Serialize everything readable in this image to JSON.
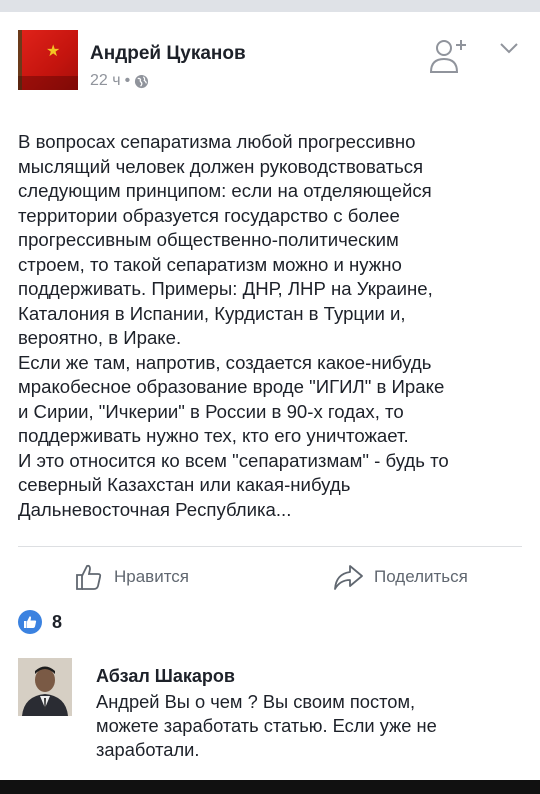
{
  "post": {
    "author": "Андрей Цуканов",
    "time": "22 ч",
    "separator": "•",
    "text": "В вопросах сепаратизма любой прогрессивно\nмыслящий человек должен руководствоваться\nследующим принципом: если на отделяющейся\nтерритории образуется государство с более\nпрогрессивным общественно-политическим\nстроем, то такой сепаратизм можно и нужно\nподдерживать. Примеры: ДНР, ЛНР на Украине,\nКаталония в Испании, Курдистан в Турции и,\nвероятно, в Ираке.\nЕсли же там, напротив, создается какое-нибудь\nмракобесное образование вроде \"ИГИЛ\" в Ираке\nи Сирии, \"Ичкерии\" в России в 90-х годах, то\nподдерживать нужно тех, кто его уничтожает.\nИ это относится ко всем \"сепаратизмам\" - будь то\nсеверный Казахстан или какая-нибудь\nДальневосточная Республика..."
  },
  "actions": {
    "like_label": "Нравится",
    "share_label": "Поделиться"
  },
  "reactions": {
    "like_count": "8"
  },
  "comment": {
    "author": "Абзал Шакаров",
    "text": "Андрей Вы о чем ? Вы своим постом,\nможете заработать статью. Если уже не\nзаработали."
  },
  "icons": {
    "globe": "globe-icon",
    "add_friend": "add-friend-icon",
    "chevron": "chevron-down-icon",
    "like": "thumbs-up-icon",
    "share": "share-arrow-icon"
  },
  "colors": {
    "accent": "#3b82e0",
    "meta": "#90949c",
    "text": "#1d2129"
  }
}
